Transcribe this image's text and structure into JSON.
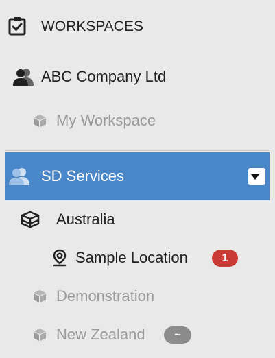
{
  "header": {
    "title": "WORKSPACES",
    "icon": "clipboard-check-icon"
  },
  "company": {
    "label": "ABC Company Ltd",
    "icon": "users-icon"
  },
  "my_workspace": {
    "label": "My Workspace",
    "icon": "cube-icon"
  },
  "selected_group": {
    "label": "SD Services",
    "icon": "users-icon",
    "dropdown_icon": "caret-down-icon",
    "highlight_color": "#4a87c9"
  },
  "groups": [
    {
      "label": "Australia",
      "icon": "cubes-icon"
    }
  ],
  "locations": [
    {
      "label": "Sample Location",
      "icon": "map-marker-icon",
      "badge": "1",
      "badge_color": "#c93a35"
    }
  ],
  "other_workspaces": [
    {
      "label": "Demonstration",
      "icon": "cube-icon"
    },
    {
      "label": "New Zealand",
      "icon": "cube-icon",
      "badge": "~",
      "badge_color": "#8c8c8c"
    }
  ]
}
